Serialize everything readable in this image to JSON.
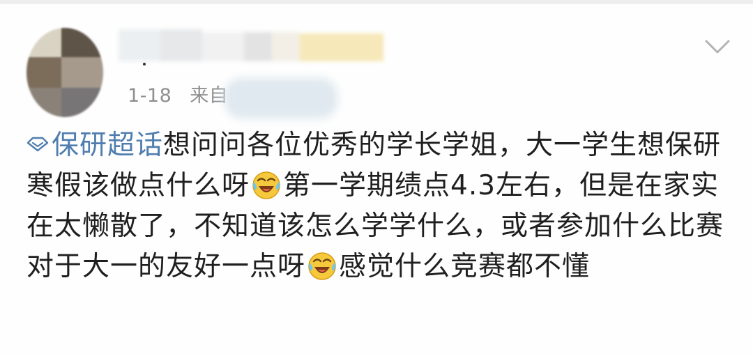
{
  "post": {
    "meta": {
      "date": "1-18",
      "source_label": "来自"
    },
    "topic": "保研超话",
    "segments": [
      "想问问各位优秀的学长学姐，大一学生想保研寒假该做点什么呀",
      "第一学期绩点4.3左右，但是在家实在太懒散了，不知道该怎么学学什么，或者参加什么比赛对于大一的友好一点呀",
      "感觉什么竞赛都不懂"
    ],
    "icons": {
      "topic": "diamond-topic-icon",
      "emoji": "laugh-cry-emoji-icon",
      "more": "chevron-down-icon"
    },
    "colors": {
      "topic": "#507daf",
      "meta": "#8f8f8f",
      "text": "#1f1f1f"
    }
  }
}
